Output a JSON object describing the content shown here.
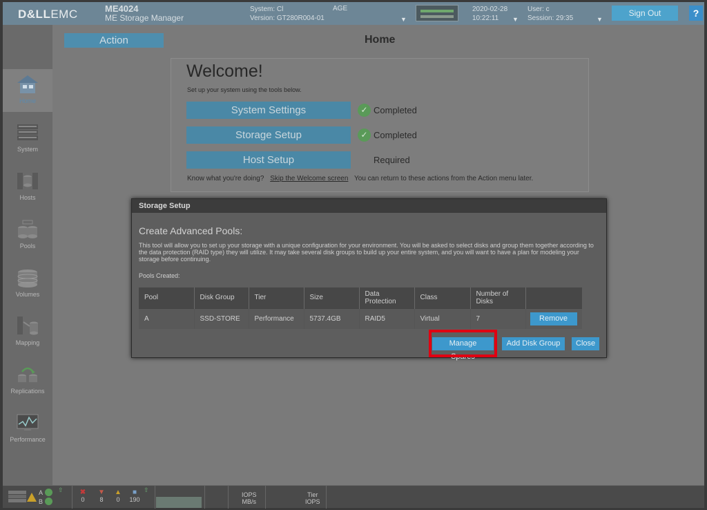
{
  "header": {
    "brand_bold": "D&LL",
    "brand_light": "EMC",
    "model": "ME4024",
    "product": "ME Storage Manager",
    "system_label": "System: Cl",
    "system_suffix": "AGE",
    "version_label": "Version: GT280R004-01",
    "date": "2020-02-28",
    "time": "10:22:11",
    "user_label": "User: c",
    "session_label": "Session: 29:35",
    "sign_out": "Sign Out",
    "help": "?"
  },
  "sidebar": {
    "items": [
      {
        "label": "Home",
        "icon": "home-icon"
      },
      {
        "label": "System",
        "icon": "system-icon"
      },
      {
        "label": "Hosts",
        "icon": "hosts-icon"
      },
      {
        "label": "Pools",
        "icon": "pools-icon"
      },
      {
        "label": "Volumes",
        "icon": "volumes-icon"
      },
      {
        "label": "Mapping",
        "icon": "mapping-icon"
      },
      {
        "label": "Replications",
        "icon": "replications-icon"
      },
      {
        "label": "Performance",
        "icon": "performance-icon"
      }
    ]
  },
  "main": {
    "action_label": "Action",
    "page_title": "Home"
  },
  "welcome": {
    "title": "Welcome!",
    "subtitle": "Set up your system using the tools below.",
    "steps": [
      {
        "label": "System Settings",
        "status": "Completed"
      },
      {
        "label": "Storage Setup",
        "status": "Completed"
      },
      {
        "label": "Host Setup",
        "status": "Required"
      }
    ],
    "footer_prompt": "Know what you're doing?",
    "skip_link": "Skip the Welcome screen",
    "footer_note": "You can return to these actions from the Action menu later."
  },
  "modal": {
    "title": "Storage Setup",
    "heading": "Create Advanced Pools:",
    "description": "This tool will allow you to set up your storage with a unique configuration for your environment. You will be asked to select disks and group them together according to the data protection (RAID type) they will utilize. It may take several disk groups to build up your entire system, and you will want to have a plan for modeling your storage before continuing.",
    "pools_created_label": "Pools Created:",
    "columns": [
      "Pool",
      "Disk Group",
      "Tier",
      "Size",
      "Data Protection",
      "Class",
      "Number of Disks"
    ],
    "rows": [
      {
        "pool": "A",
        "disk_group": "SSD-STORE",
        "tier": "Performance",
        "size": "5737.4GB",
        "protection": "RAID5",
        "class": "Virtual",
        "disks": "7",
        "action": "Remove"
      }
    ],
    "buttons": {
      "manage_spares": "Manage Spares",
      "add_disk_group": "Add Disk Group",
      "close": "Close"
    }
  },
  "footer": {
    "controller_a": "A",
    "controller_b": "B",
    "errors": "0",
    "critical": "8",
    "warnings": "0",
    "info": "190",
    "iops_label": "IOPS",
    "mbs_label": "MB/s",
    "tier_label": "Tier",
    "tier_iops_label": "IOPS"
  },
  "colors": {
    "header": "#6d8696",
    "accent_button": "#3d98cc",
    "highlight": "#e00012",
    "ok": "#5a9a58"
  }
}
